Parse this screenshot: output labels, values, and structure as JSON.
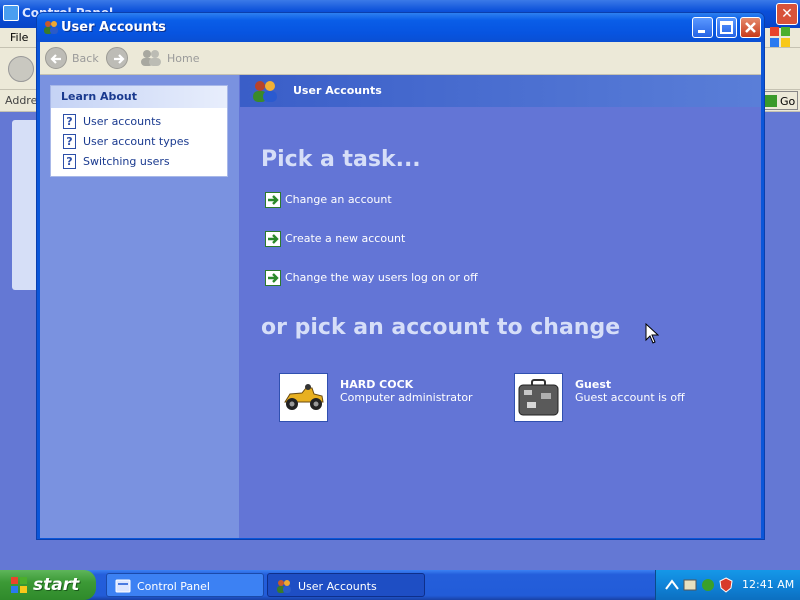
{
  "background_window": {
    "title": "Control Panel",
    "menu_file": "File",
    "address_label": "Address",
    "go_label": "Go"
  },
  "window": {
    "title": "User Accounts",
    "toolbar": {
      "back_label": "Back",
      "home_label": "Home"
    }
  },
  "sidebar": {
    "learn_about": {
      "header": "Learn About",
      "items": [
        {
          "label": "User accounts"
        },
        {
          "label": "User account types"
        },
        {
          "label": "Switching users"
        }
      ]
    }
  },
  "main": {
    "header_title": "User Accounts",
    "pick_task_heading": "Pick a task...",
    "tasks": [
      {
        "label": "Change an account"
      },
      {
        "label": "Create a new account"
      },
      {
        "label": "Change the way users log on or off"
      }
    ],
    "pick_account_heading": "or pick an account to change",
    "accounts": [
      {
        "name": "HARD COCK",
        "type": "Computer administrator",
        "picture": "race-car-icon"
      },
      {
        "name": "Guest",
        "type": "Guest account is off",
        "picture": "suitcase-icon"
      }
    ]
  },
  "taskbar": {
    "start_label": "start",
    "buttons": [
      {
        "label": "Control Panel"
      },
      {
        "label": "User Accounts"
      }
    ],
    "clock": "12:41 AM"
  },
  "colors": {
    "content_bg": "#6375d6",
    "sidebar_bg": "#7a92e0",
    "titlebar_blue": "#0754e0",
    "start_green": "#3c9a36",
    "heading_text": "#d6def8"
  }
}
